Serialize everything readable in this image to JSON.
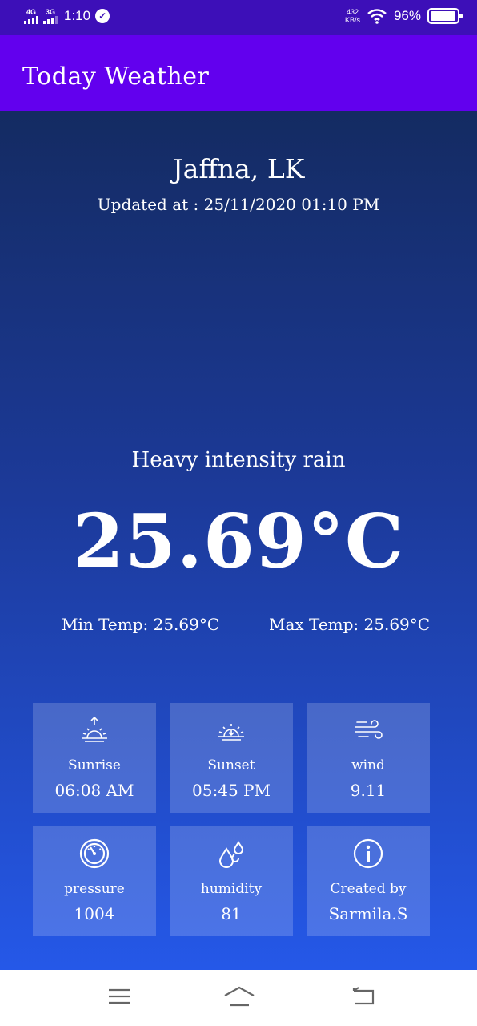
{
  "status_bar": {
    "network_1": "4G",
    "network_2": "3G",
    "time": "1:10",
    "speed_value": "432",
    "speed_unit": "KB/s",
    "battery_text": "96%",
    "battery_level": 0.96
  },
  "app_bar": {
    "title": "Today Weather"
  },
  "weather": {
    "location": "Jaffna, LK",
    "updated_at": "Updated at : 25/11/2020 01:10 PM",
    "status": "Heavy intensity rain",
    "temperature": "25.69°C",
    "min_temp": "Min Temp: 25.69°C",
    "max_temp": "Max Temp: 25.69°C"
  },
  "details": [
    {
      "icon": "sunrise-icon",
      "label": "Sunrise",
      "value": "06:08 AM"
    },
    {
      "icon": "sunset-icon",
      "label": "Sunset",
      "value": "05:45 PM"
    },
    {
      "icon": "wind-icon",
      "label": "wind",
      "value": "9.11"
    },
    {
      "icon": "pressure-gauge-icon",
      "label": "pressure",
      "value": "1004"
    },
    {
      "icon": "humidity-drops-icon",
      "label": "humidity",
      "value": "81"
    },
    {
      "icon": "info-icon",
      "label": "Created by",
      "value": "Sarmila.S"
    }
  ],
  "nav_bar": {
    "buttons": [
      "menu-icon",
      "home-icon",
      "back-icon"
    ]
  }
}
